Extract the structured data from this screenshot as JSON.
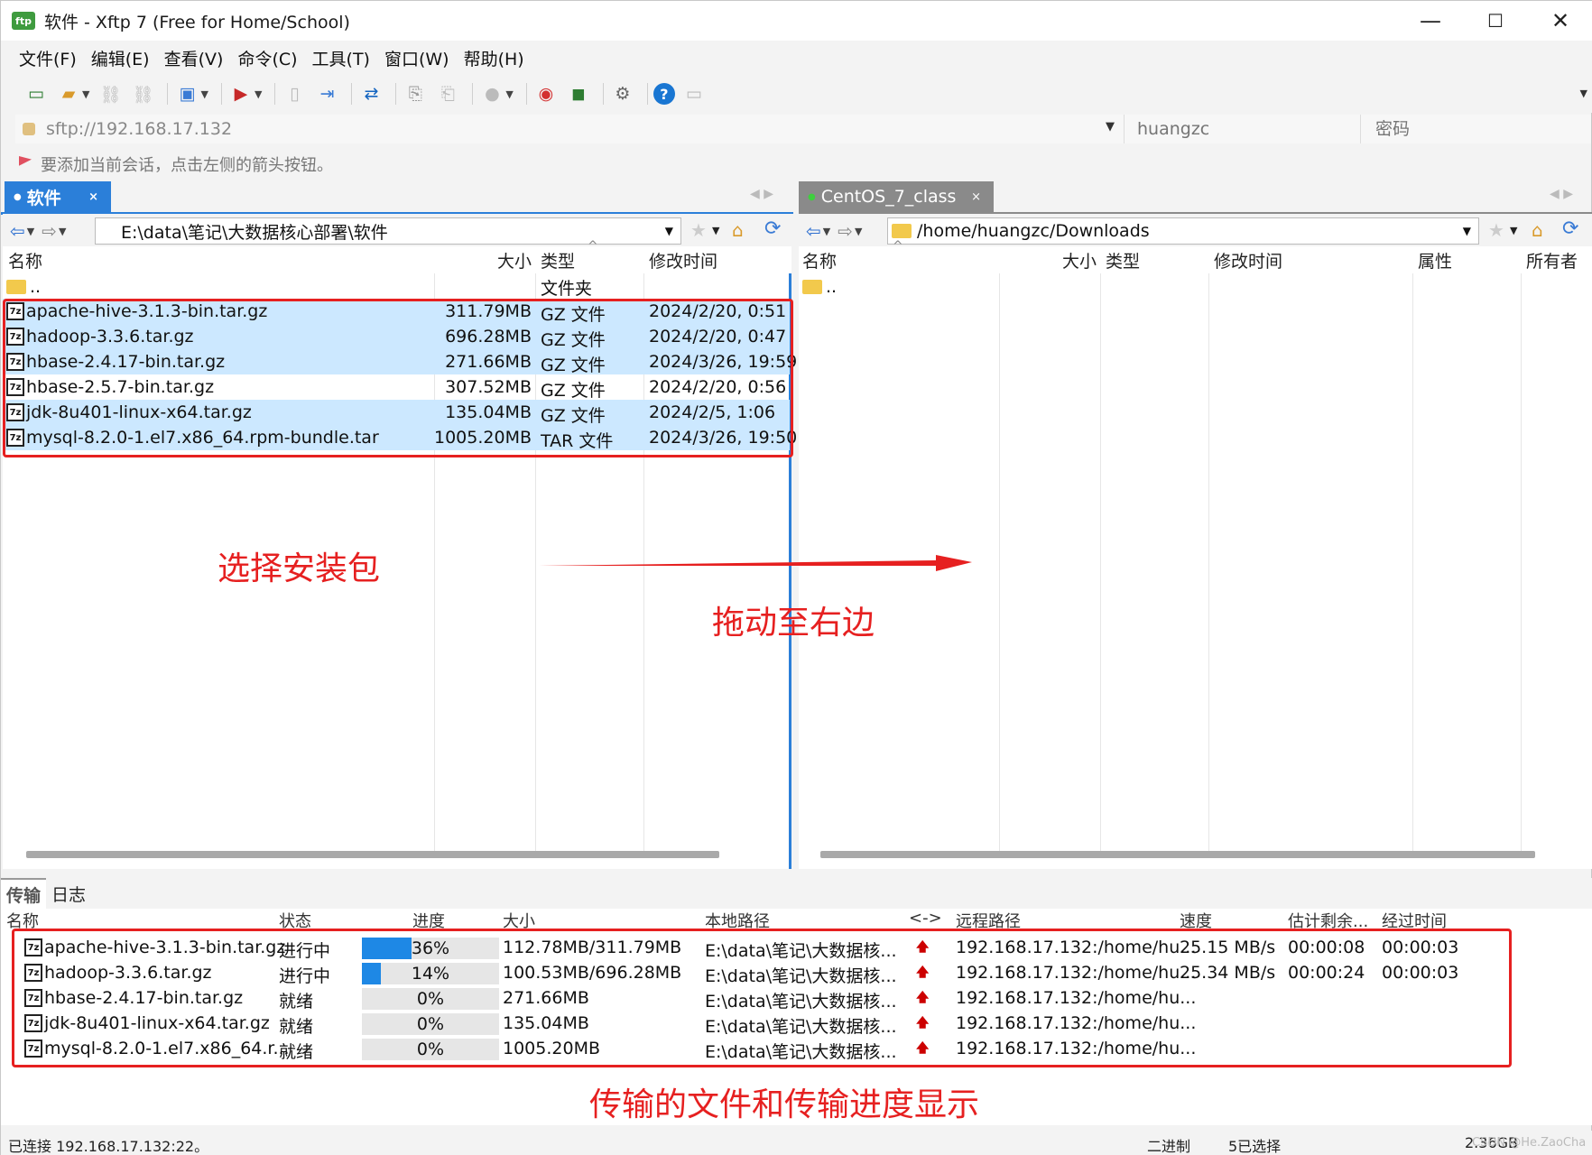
{
  "window": {
    "title": "软件 - Xftp 7 (Free for Home/School)",
    "minimize": "—",
    "maximize": "☐",
    "close": "✕"
  },
  "menu": [
    "文件(F)",
    "编辑(E)",
    "查看(V)",
    "命令(C)",
    "工具(T)",
    "窗口(W)",
    "帮助(H)"
  ],
  "address": {
    "value": "sftp://192.168.17.132",
    "user_placeholder": "huangzc",
    "password_placeholder": "密码"
  },
  "hint": "要添加当前会话，点击左侧的箭头按钮。",
  "left": {
    "tab": "软件",
    "path": "E:\\data\\笔记\\大数据核心部署\\软件",
    "columns": {
      "name": "名称",
      "size": "大小",
      "type": "类型",
      "modified": "修改时间"
    },
    "parent": {
      "name": "..",
      "type": "文件夹"
    },
    "files": [
      {
        "name": "apache-hive-3.1.3-bin.tar.gz",
        "size": "311.79MB",
        "type": "GZ 文件",
        "modified": "2024/2/20, 0:51"
      },
      {
        "name": "hadoop-3.3.6.tar.gz",
        "size": "696.28MB",
        "type": "GZ 文件",
        "modified": "2024/2/20, 0:47"
      },
      {
        "name": "hbase-2.4.17-bin.tar.gz",
        "size": "271.66MB",
        "type": "GZ 文件",
        "modified": "2024/3/26, 19:59"
      },
      {
        "name": "hbase-2.5.7-bin.tar.gz",
        "size": "307.52MB",
        "type": "GZ 文件",
        "modified": "2024/2/20, 0:56"
      },
      {
        "name": "jdk-8u401-linux-x64.tar.gz",
        "size": "135.04MB",
        "type": "GZ 文件",
        "modified": "2024/2/5, 1:06"
      },
      {
        "name": "mysql-8.2.0-1.el7.x86_64.rpm-bundle.tar",
        "size": "1005.20MB",
        "type": "TAR 文件",
        "modified": "2024/3/26, 19:50"
      }
    ]
  },
  "right": {
    "tab": "CentOS_7_class",
    "path": "/home/huangzc/Downloads",
    "columns": {
      "name": "名称",
      "size": "大小",
      "type": "类型",
      "modified": "修改时间",
      "attr": "属性",
      "owner": "所有者"
    },
    "parent": {
      "name": ".."
    }
  },
  "transfer": {
    "tabs": [
      "传输",
      "日志"
    ],
    "columns": {
      "name": "名称",
      "status": "状态",
      "progress": "进度",
      "size": "大小",
      "local": "本地路径",
      "dir": "<->",
      "remote": "远程路径",
      "speed": "速度",
      "eta": "估计剩余...",
      "elapsed": "经过时间"
    },
    "rows": [
      {
        "name": "apache-hive-3.1.3-bin.tar.gz",
        "status": "进行中",
        "progress": 0.36,
        "progress_text": "36%",
        "size": "112.78MB/311.79MB",
        "local": "E:\\data\\笔记\\大数据核...",
        "remote": "192.168.17.132:/home/hu...",
        "speed": "25.15 MB/s",
        "eta": "00:00:08",
        "elapsed": "00:00:03"
      },
      {
        "name": "hadoop-3.3.6.tar.gz",
        "status": "进行中",
        "progress": 0.14,
        "progress_text": "14%",
        "size": "100.53MB/696.28MB",
        "local": "E:\\data\\笔记\\大数据核...",
        "remote": "192.168.17.132:/home/hu...",
        "speed": "25.34 MB/s",
        "eta": "00:00:24",
        "elapsed": "00:00:03"
      },
      {
        "name": "hbase-2.4.17-bin.tar.gz",
        "status": "就绪",
        "progress": 0,
        "progress_text": "0%",
        "size": "271.66MB",
        "local": "E:\\data\\笔记\\大数据核...",
        "remote": "192.168.17.132:/home/hu...",
        "speed": "",
        "eta": "",
        "elapsed": ""
      },
      {
        "name": "jdk-8u401-linux-x64.tar.gz",
        "status": "就绪",
        "progress": 0,
        "progress_text": "0%",
        "size": "135.04MB",
        "local": "E:\\data\\笔记\\大数据核...",
        "remote": "192.168.17.132:/home/hu...",
        "speed": "",
        "eta": "",
        "elapsed": ""
      },
      {
        "name": "mysql-8.2.0-1.el7.x86_64.r...",
        "status": "就绪",
        "progress": 0,
        "progress_text": "0%",
        "size": "1005.20MB",
        "local": "E:\\data\\笔记\\大数据核...",
        "remote": "192.168.17.132:/home/hu...",
        "speed": "",
        "eta": "",
        "elapsed": ""
      }
    ]
  },
  "status": {
    "connection": "已连接 192.168.17.132:22。",
    "mode": "二进制",
    "selected": "5已选择",
    "total": "2.36GB",
    "watermark": "CSDN @He.ZaoCha"
  },
  "annotations": {
    "select": "选择安装包",
    "drag": "拖动至右边",
    "transfer": "传输的文件和传输进度显示"
  },
  "colors": {
    "accent": "#1e88e5",
    "selection": "#cce8ff",
    "annotation": "#e62020",
    "active_tab": "#2b7fd9",
    "inactive_tab": "#8a8a8a"
  }
}
